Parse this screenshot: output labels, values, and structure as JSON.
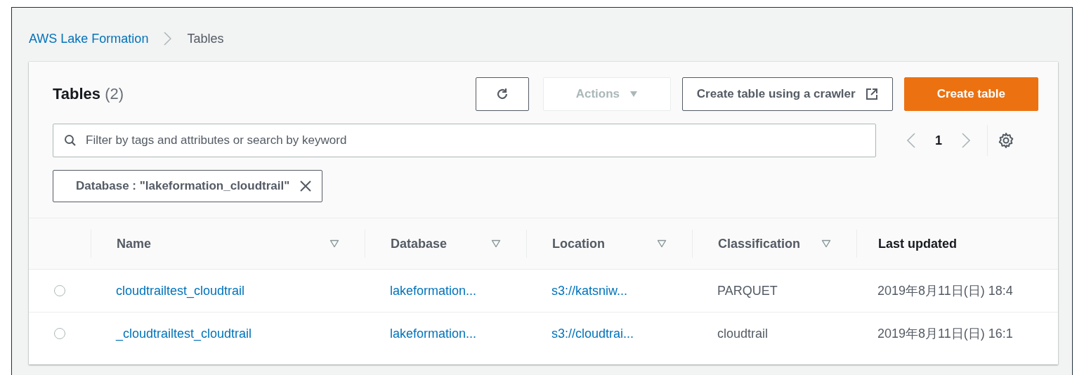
{
  "breadcrumb": [
    {
      "label": "AWS Lake Formation",
      "link": true
    },
    {
      "label": "Tables",
      "link": false
    }
  ],
  "panel": {
    "title": "Tables",
    "count": "(2)",
    "buttons": [
      {
        "kind": "refresh",
        "disabled": false
      },
      {
        "kind": "dropdown",
        "label": "Actions",
        "disabled": true
      },
      {
        "kind": "external",
        "label": "Create table using a crawler",
        "disabled": false
      },
      {
        "kind": "primary",
        "label": "Create table",
        "disabled": false
      }
    ],
    "search": {
      "placeholder": "Filter by tags and attributes or search by keyword"
    },
    "pagination": {
      "page": "1"
    },
    "filter_tokens": [
      {
        "label": "Database : \"lakeformation_cloudtrail\""
      }
    ]
  },
  "table": {
    "columns": [
      {
        "label": "Name",
        "sortable": true
      },
      {
        "label": "Database",
        "sortable": true
      },
      {
        "label": "Location",
        "sortable": true
      },
      {
        "label": "Classification",
        "sortable": true
      },
      {
        "label": "Last updated",
        "sortable": false
      }
    ],
    "rows": [
      {
        "selected": false,
        "cells": [
          {
            "text": "cloudtrailtest_cloudtrail",
            "link": true
          },
          {
            "text": "lakeformation...",
            "link": true
          },
          {
            "text": "s3://katsniw...",
            "link": true
          },
          {
            "text": "PARQUET",
            "link": false
          },
          {
            "text": "2019年8月11日(日) 18:4",
            "link": false
          }
        ]
      },
      {
        "selected": false,
        "cells": [
          {
            "text": "_cloudtrailtest_cloudtrail",
            "link": true
          },
          {
            "text": "lakeformation...",
            "link": true
          },
          {
            "text": "s3://cloudtrai...",
            "link": true
          },
          {
            "text": "cloudtrail",
            "link": false
          },
          {
            "text": "2019年8月11日(日) 16:1",
            "link": false
          }
        ]
      }
    ]
  }
}
